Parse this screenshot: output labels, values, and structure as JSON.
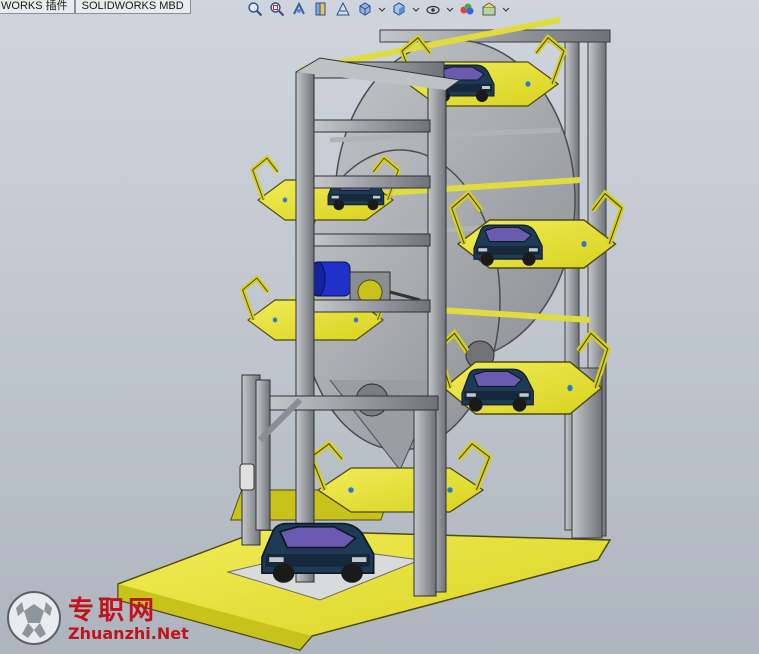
{
  "tabs": [
    {
      "label": "WORKS 插件"
    },
    {
      "label": "SOLIDWORKS MBD"
    }
  ],
  "view_toolbar": {
    "icons": [
      "zoom-to-fit-icon",
      "zoom-to-area-icon",
      "previous-view-icon",
      "section-view-icon",
      "dynamic-annotation-icon",
      "view-orientation-icon",
      "display-style-icon",
      "hide-show-items-icon",
      "edit-appearance-icon",
      "apply-scene-icon",
      "view-settings-icon"
    ]
  },
  "watermark": {
    "brand_cn": "专职网",
    "url": "Zhuanzhi.Net"
  },
  "colors": {
    "viewport_bg": "#c4cbd2",
    "frame_yellow": "#e8e33a",
    "steel_gray": "#9ea2a6",
    "car_body": "#1f3a55",
    "motor_blue": "#2030c8",
    "watermark_red": "#c0141c"
  }
}
